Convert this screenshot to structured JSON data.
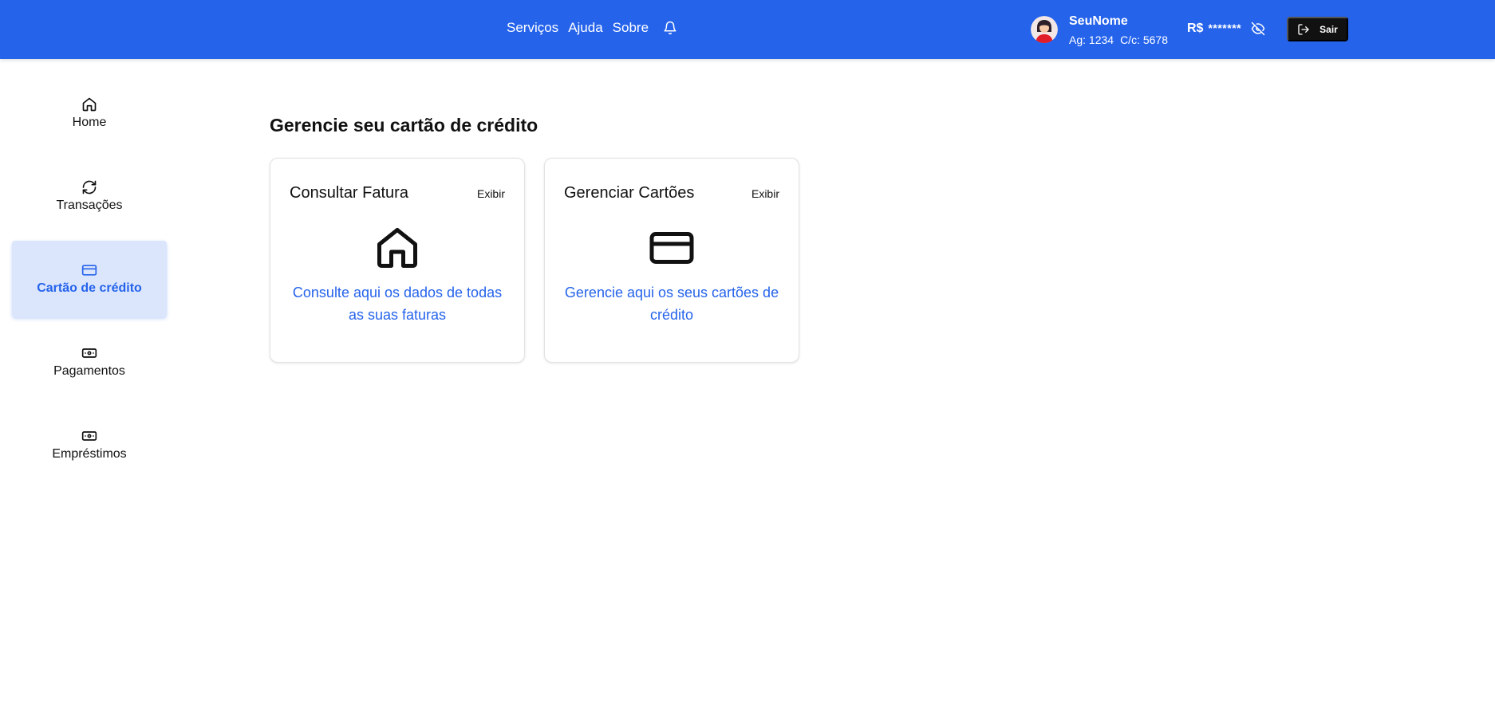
{
  "header": {
    "nav": [
      {
        "label": "Serviços"
      },
      {
        "label": "Ajuda"
      },
      {
        "label": "Sobre"
      }
    ],
    "notification_icon": "bell-icon",
    "user": {
      "name": "SeuNome",
      "agency": "Ag: 1234",
      "account": "C/c: 5678",
      "avatar_icon": "user-avatar"
    },
    "balance": {
      "currency": "R$",
      "masked_value": "*******",
      "toggle_icon": "eye-off-icon"
    },
    "logout_label": "Sair",
    "background_color": "#2563eb"
  },
  "sidebar": {
    "items": [
      {
        "label": "Home",
        "icon": "home-icon",
        "active": false
      },
      {
        "label": "Transações",
        "icon": "refresh-icon",
        "active": false
      },
      {
        "label": "Cartão de crédito",
        "icon": "credit-card-icon",
        "active": true
      },
      {
        "label": "Pagamentos",
        "icon": "banknote-icon",
        "active": false
      },
      {
        "label": "Empréstimos",
        "icon": "banknote-icon",
        "active": false
      }
    ],
    "active_color": "#2563eb",
    "active_background": "#dbe6fc"
  },
  "main": {
    "title": "Gerencie seu cartão de crédito",
    "cards": [
      {
        "title": "Consultar Fatura",
        "action": "Exibir",
        "icon": "home-icon",
        "description": "Consulte aqui os dados de todas as suas faturas"
      },
      {
        "title": "Gerenciar Cartões",
        "action": "Exibir",
        "icon": "credit-card-icon",
        "description": "Gerencie aqui os seus cartões de crédito"
      }
    ]
  }
}
